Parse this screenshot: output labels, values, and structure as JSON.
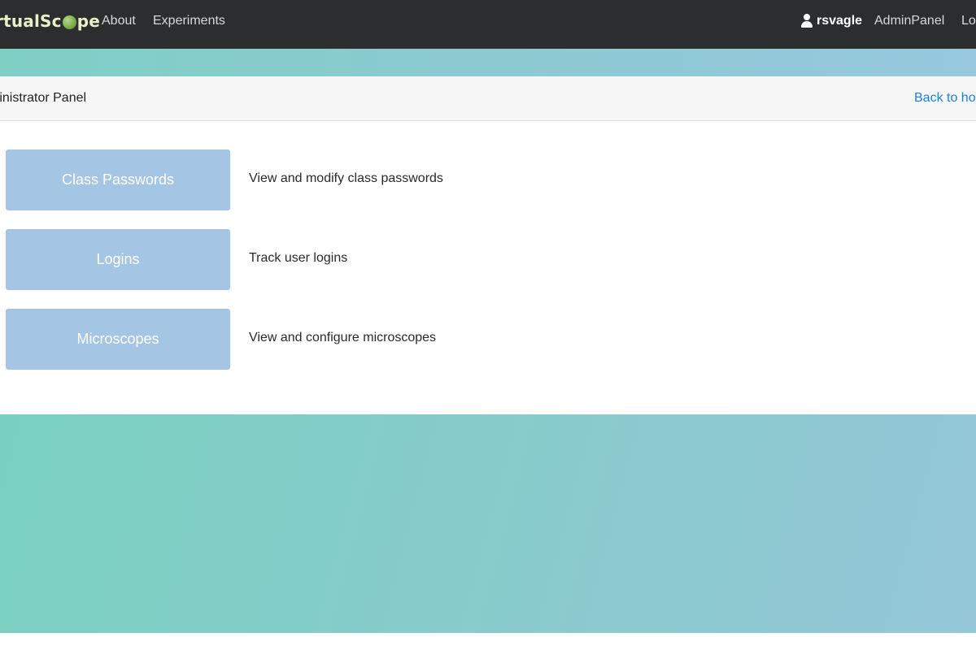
{
  "navbar": {
    "brand_prefix": "rtualSc",
    "brand_suffix": "pe",
    "brand_lens_icon": "microscope-lens-icon",
    "links": {
      "about": "About",
      "experiments": "Experiments"
    },
    "user": {
      "icon": "user-icon",
      "name": "rsvagle"
    },
    "admin_panel": "AdminPanel",
    "logout": "Lo"
  },
  "panel": {
    "title": "ministrator Panel",
    "back_link": "Back to ho"
  },
  "actions": [
    {
      "label": "Class Passwords",
      "description": "View and modify class passwords"
    },
    {
      "label": "Logins",
      "description": "Track user logins"
    },
    {
      "label": "Microscopes",
      "description": "View and configure microscopes"
    }
  ],
  "colors": {
    "navbar_bg": "#2c2d2f",
    "button_bg": "#a4c6e4",
    "link": "#1a7fe0",
    "gradient_start": "#79d0c0",
    "gradient_end": "#97c8de"
  }
}
